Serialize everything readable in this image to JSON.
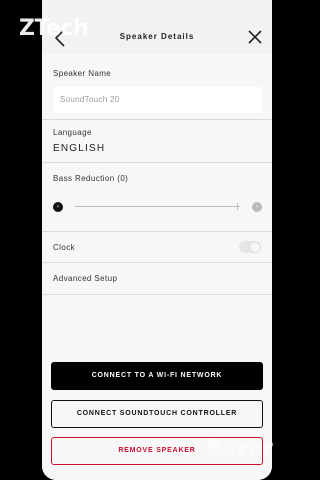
{
  "watermark": {
    "top_text": "ZTech",
    "bottom_text": "Bazar"
  },
  "header": {
    "title": "Speaker Details",
    "back_icon": "chevron-left-icon",
    "close_icon": "close-icon"
  },
  "speaker_name": {
    "label": "Speaker Name",
    "value": "SoundTouch 20"
  },
  "language": {
    "label": "Language",
    "value": "ENGLISH"
  },
  "bass": {
    "label": "Bass Reduction (0)",
    "level_fraction": 0,
    "min_glyph": "‹",
    "max_glyph": "›"
  },
  "clock": {
    "label": "Clock",
    "enabled": false
  },
  "advanced": {
    "label": "Advanced Setup"
  },
  "buttons": {
    "wifi": "CONNECT TO A WI-FI NETWORK",
    "controller": "CONNECT SOUNDTOUCH CONTROLLER",
    "remove": "REMOVE SPEAKER"
  },
  "colors": {
    "remove_accent": "#c8102e",
    "primary_button": "#000000"
  }
}
